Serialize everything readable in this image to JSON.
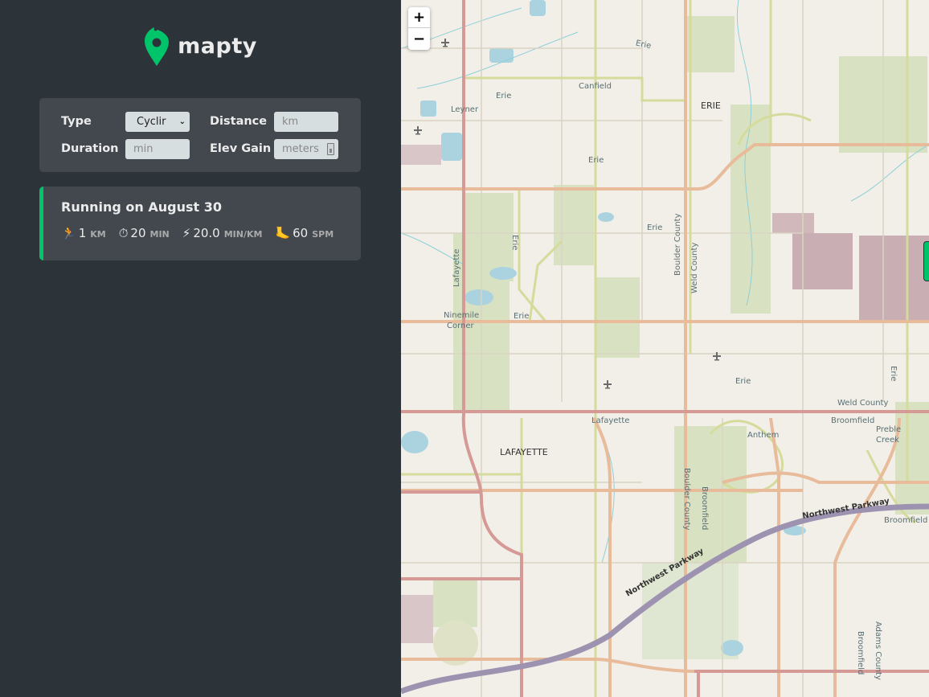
{
  "app": {
    "name": "mapty",
    "brand_color": "#00c46a"
  },
  "form": {
    "type_label": "Type",
    "type_value": "Cyclir",
    "distance_label": "Distance",
    "distance_placeholder": "km",
    "duration_label": "Duration",
    "duration_placeholder": "min",
    "elev_label": "Elev Gain",
    "elev_placeholder": "meters"
  },
  "workouts": [
    {
      "title": "Running on August 30",
      "type": "running",
      "accent": "#00c46a",
      "details": [
        {
          "icon": "runner-icon",
          "glyph": "🏃",
          "value": "1",
          "unit": "km"
        },
        {
          "icon": "stopwatch-icon",
          "glyph": "⏱",
          "value": "20",
          "unit": "min"
        },
        {
          "icon": "lightning-icon",
          "glyph": "⚡",
          "value": "20.0",
          "unit": "min/km"
        },
        {
          "icon": "foot-icon",
          "glyph": "🦶",
          "value": "60",
          "unit": "spm"
        }
      ]
    }
  ],
  "map": {
    "zoom_in": "+",
    "zoom_out": "−",
    "labels": {
      "erie_top": "Erie",
      "canfield": "Canfield",
      "leyner": "Leyner",
      "erie_2": "Erie",
      "erie_town": "ERIE",
      "erie_3": "Erie",
      "erie_4": "Erie",
      "erie_5": "Erie",
      "lafayette_rd": "Lafayette",
      "ninemile": "Ninemile",
      "corner": "Corner",
      "erie_6": "Erie",
      "boulder_county": "Boulder County",
      "weld_county": "Weld County",
      "erie_7": "Erie",
      "erie_8": "Erie",
      "weld_county_2": "Weld County",
      "lafayette": "Lafayette",
      "lafayette_town": "LAFAYETTE",
      "anthem": "Anthem",
      "broomfield": "Broomfield",
      "preble": "Preble",
      "creek": "Creek",
      "boulder_county_2": "Boulder County",
      "broomfield_2": "Broomfield",
      "nw_parkway": "Northwest Parkway",
      "nw_parkway_2": "Northwest Parkway",
      "broomfield_3": "Broomfield",
      "broomfield_4": "Broomfield",
      "adams_county": "Adams County"
    }
  }
}
